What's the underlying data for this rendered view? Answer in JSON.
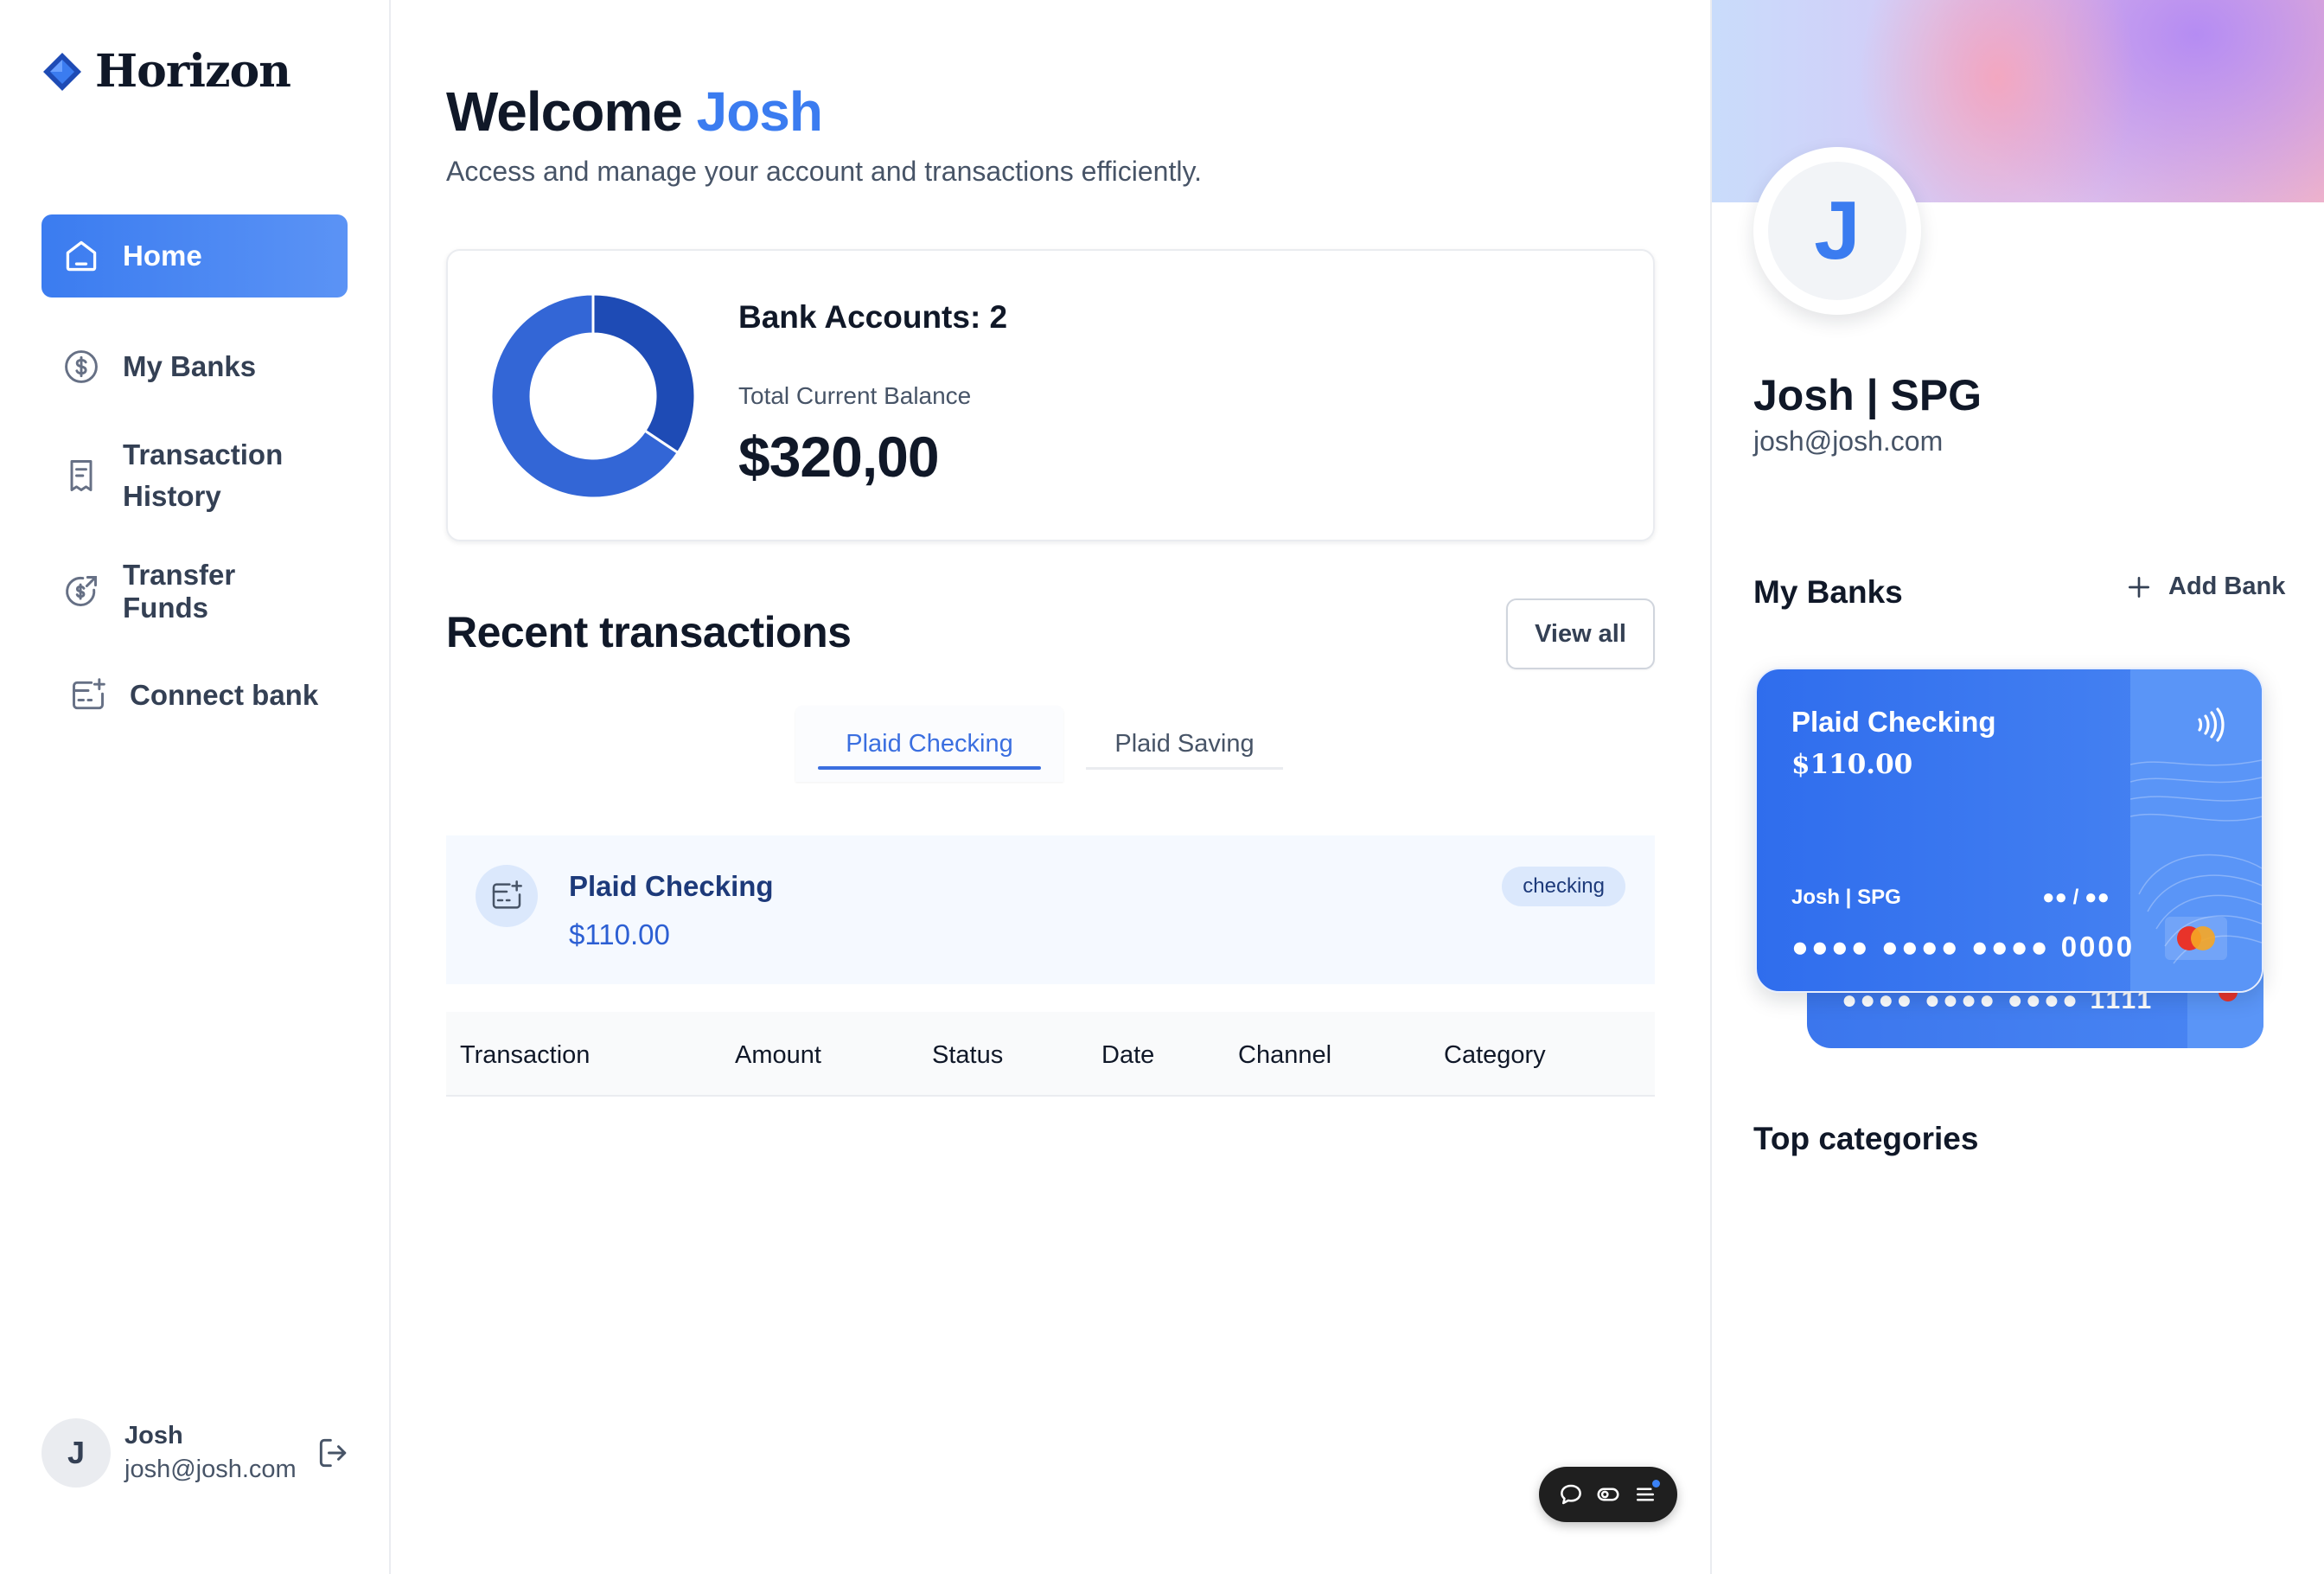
{
  "sidebar": {
    "logo_text": "Horizon",
    "nav": [
      {
        "label": "Home",
        "icon": "home-icon",
        "active": true
      },
      {
        "label": "My Banks",
        "icon": "dollar-circle-icon",
        "active": false
      },
      {
        "label": "Transaction History",
        "icon": "receipt-icon",
        "active": false
      },
      {
        "label": "Transfer Funds",
        "icon": "transfer-icon",
        "active": false
      },
      {
        "label": "Connect bank",
        "icon": "connect-bank-icon",
        "active": false
      }
    ],
    "user": {
      "initial": "J",
      "name": "Josh",
      "email": "josh@josh.com"
    }
  },
  "main": {
    "welcome_prefix": "Welcome",
    "welcome_name": "Josh",
    "subtitle": "Access and manage your account and transactions efficiently.",
    "balance": {
      "bank_accounts_label": "Bank Accounts: 2",
      "total_label": "Total Current Balance",
      "total_value": "$320,00",
      "donut_segments": [
        {
          "name": "Plaid Checking",
          "value": 110,
          "color": "#1e4bb5"
        },
        {
          "name": "Plaid Saving",
          "value": 210,
          "color": "#3366d6"
        }
      ]
    },
    "recent": {
      "title": "Recent transactions",
      "view_all": "View all",
      "tabs": [
        {
          "label": "Plaid Checking",
          "active": true
        },
        {
          "label": "Plaid Saving",
          "active": false
        }
      ],
      "account": {
        "name": "Plaid Checking",
        "amount": "$110.00",
        "badge": "checking"
      },
      "columns": [
        "Transaction",
        "Amount",
        "Status",
        "Date",
        "Channel",
        "Category"
      ]
    }
  },
  "right": {
    "profile": {
      "initial": "J",
      "name": "Josh | SPG",
      "email": "josh@josh.com"
    },
    "my_banks_title": "My Banks",
    "add_bank": "Add Bank",
    "card": {
      "bank": "Plaid Checking",
      "balance": "$110.00",
      "holder": "Josh | SPG",
      "expiry": "●● / ●●",
      "number": "●●●● ●●●● ●●●● 0000"
    },
    "card_back": {
      "number": "●●●● ●●●● ●●●● 1111"
    },
    "top_categories_title": "Top categories"
  },
  "colors": {
    "accent": "#3b7cf0",
    "text": "#101828",
    "muted": "#475467"
  }
}
